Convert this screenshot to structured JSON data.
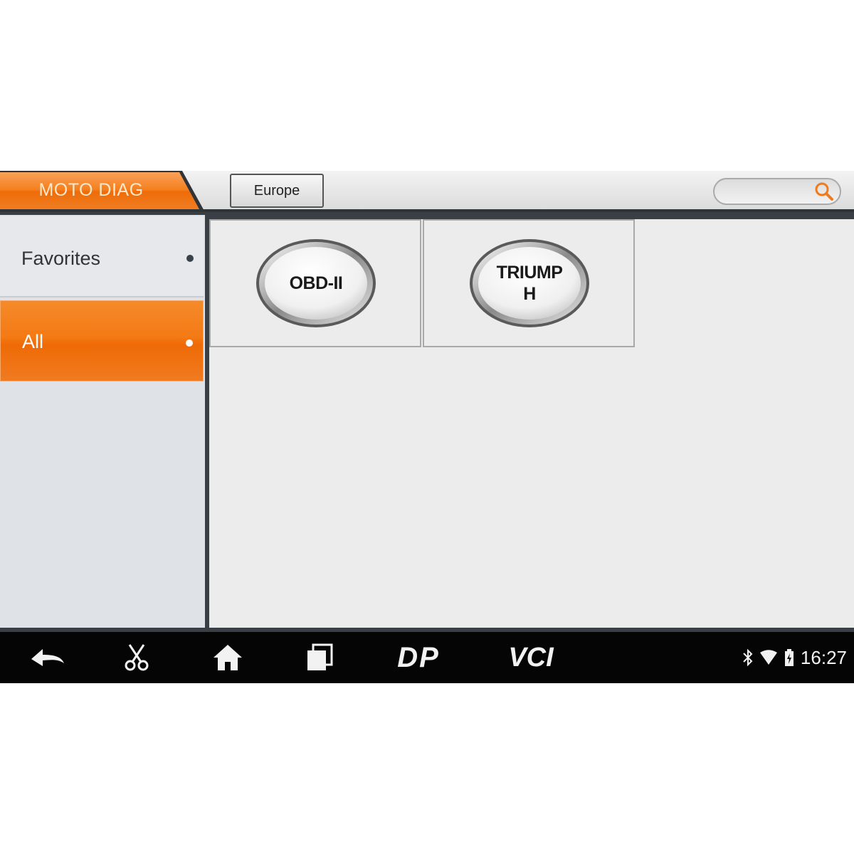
{
  "header": {
    "title": "MOTO DIAG",
    "region_button": "Europe",
    "search": {
      "placeholder": ""
    }
  },
  "sidebar": {
    "items": [
      {
        "label": "Favorites",
        "selected": false
      },
      {
        "label": "All",
        "selected": true
      }
    ]
  },
  "content": {
    "tiles": [
      {
        "label": "OBD-II"
      },
      {
        "label_line1": "TRIUMP",
        "label_line2": "H"
      }
    ]
  },
  "navbar": {
    "buttons": [
      "back-icon",
      "scissors-icon",
      "home-icon",
      "recent-apps-icon",
      "dp-icon",
      "vci-icon"
    ],
    "dp_label": "DP",
    "vci_label": "VCI"
  },
  "status_bar": {
    "icons": [
      "bluetooth-icon",
      "wifi-icon",
      "battery-icon"
    ],
    "time": "16:27"
  },
  "colors": {
    "accent": "#f47a15",
    "header_bg": "#e6e6e6",
    "sidebar_bg": "#dfe3e8",
    "navbar_bg": "#050505"
  }
}
